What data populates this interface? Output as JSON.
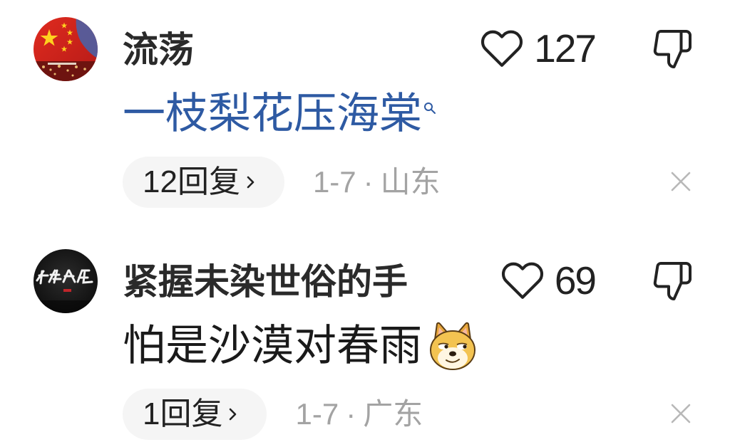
{
  "comments": [
    {
      "username": "流荡",
      "likes": "127",
      "text": "一枝梨花压海棠",
      "text_color": "#2e5aa3",
      "replies": "12回复",
      "date": "1-7",
      "separator": "·",
      "location": "山东"
    },
    {
      "username": "紧握未染世俗的手",
      "likes": "69",
      "text": "怕是沙漠对春雨",
      "text_color": "#1a1a1a",
      "emoji_icon": "doge-emoji-icon",
      "replies": "1回复",
      "date": "1-7",
      "separator": "·",
      "location": "广东"
    }
  ],
  "icons": {
    "like": "heart-icon",
    "dislike": "thumbs-down-icon",
    "replies_arrow": "chevron-right-icon",
    "search": "search-icon",
    "close": "close-icon"
  },
  "colors": {
    "background": "#ffffff",
    "username": "#2a2a2a",
    "count": "#222222",
    "meta_gray": "#a3a3a3",
    "pill_bg": "#f5f5f5",
    "link_blue": "#2e5aa3",
    "icon_gray": "#b8b8b8"
  }
}
